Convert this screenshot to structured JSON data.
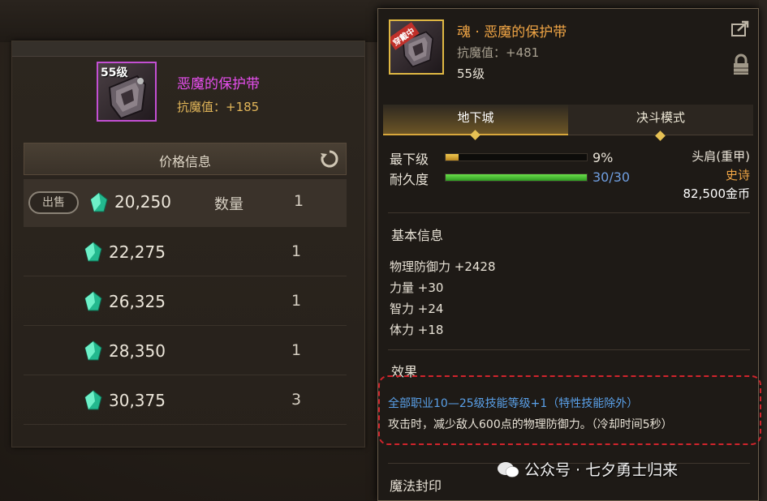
{
  "item": {
    "level_badge": "55级",
    "name": "恶魔的保护带",
    "stat": "抗魔值：+185"
  },
  "price_panel": {
    "title": "价格信息",
    "sell_label": "出售",
    "qty_label": "数量",
    "rows": [
      {
        "price": "20,250",
        "qty": "1"
      },
      {
        "price": "22,275",
        "qty": "1"
      },
      {
        "price": "26,325",
        "qty": "1"
      },
      {
        "price": "28,350",
        "qty": "1"
      },
      {
        "price": "30,375",
        "qty": "3"
      }
    ]
  },
  "tooltip": {
    "equip_tag": "穿戴中",
    "name": "魂 · 恶魔的保护带",
    "stat": "抗魔值：+481",
    "level": "55级",
    "tabs": [
      "地下城",
      "决斗模式"
    ],
    "min_level_label": "最下级",
    "min_level_pct": "9%",
    "min_level_fraction": 0.09,
    "durability_label": "耐久度",
    "durability": "30/30",
    "durability_fraction": 1.0,
    "slot": "头肩(重甲)",
    "rarity": "史诗",
    "price": "82,500金币",
    "basic_title": "基本信息",
    "basic_stats": [
      "物理防御力 +2428",
      "力量 +30",
      "智力 +24",
      "体力 +18"
    ],
    "effect_title": "效果",
    "effect_line1": "全部职业10—25级技能等级+1（特性技能除外）",
    "effect_line2": "攻击时，减少敌人600点的物理防御力。（冷却时间5秒）",
    "magic_seal_title": "魔法封印"
  },
  "watermark": "公众号 · 七夕勇士归来",
  "colors": {
    "epic_orange": "#f0a545",
    "rare_pink": "#e84ff0",
    "stat_gold": "#e2b659",
    "effect_blue": "#5aa0e8",
    "highlight_red": "#d0242c"
  }
}
